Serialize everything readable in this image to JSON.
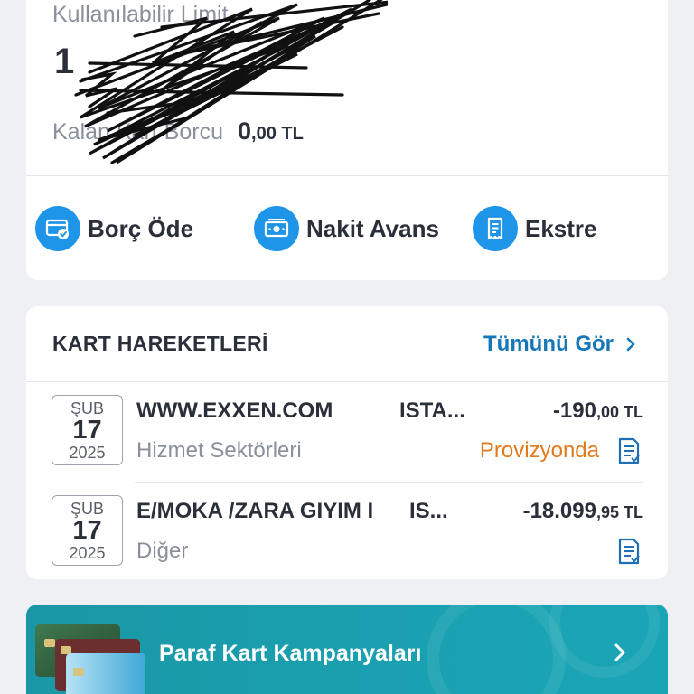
{
  "summary": {
    "limit_label": "Kullanılabilir Limit",
    "limit_value": "1",
    "debt_label": "Kalan Kart Borcu",
    "debt_value_main": "0",
    "debt_value_cents": ",00 TL"
  },
  "actions": [
    {
      "label": "Borç Öde",
      "icon": "card-pay-icon"
    },
    {
      "label": "Nakit Avans",
      "icon": "cash-icon"
    },
    {
      "label": "Ekstre",
      "icon": "receipt-icon"
    }
  ],
  "transactions": {
    "title": "KART HAREKETLERİ",
    "see_all": "Tümünü Gör",
    "items": [
      {
        "month": "ŞUB",
        "day": "17",
        "year": "2025",
        "merchant": "WWW.EXXEN.COM",
        "city": "ISTA...",
        "amount_main": "-190",
        "amount_cents": ",00 TL",
        "category": "Hizmet Sektörleri",
        "status": "Provizyonda"
      },
      {
        "month": "ŞUB",
        "day": "17",
        "year": "2025",
        "merchant": "E/MOKA /ZARA GIYIM I",
        "city": "IS...",
        "amount_main": "-18.099",
        "amount_cents": ",95 TL",
        "category": "Diğer",
        "status": ""
      }
    ]
  },
  "promo": {
    "label": "Paraf Kart Kampanyaları",
    "card_brand": "troy"
  },
  "colors": {
    "accent_blue": "#1e95e8",
    "link_blue": "#1677b8",
    "status_orange": "#e27a1c",
    "promo_teal": "#1aa0b0"
  }
}
